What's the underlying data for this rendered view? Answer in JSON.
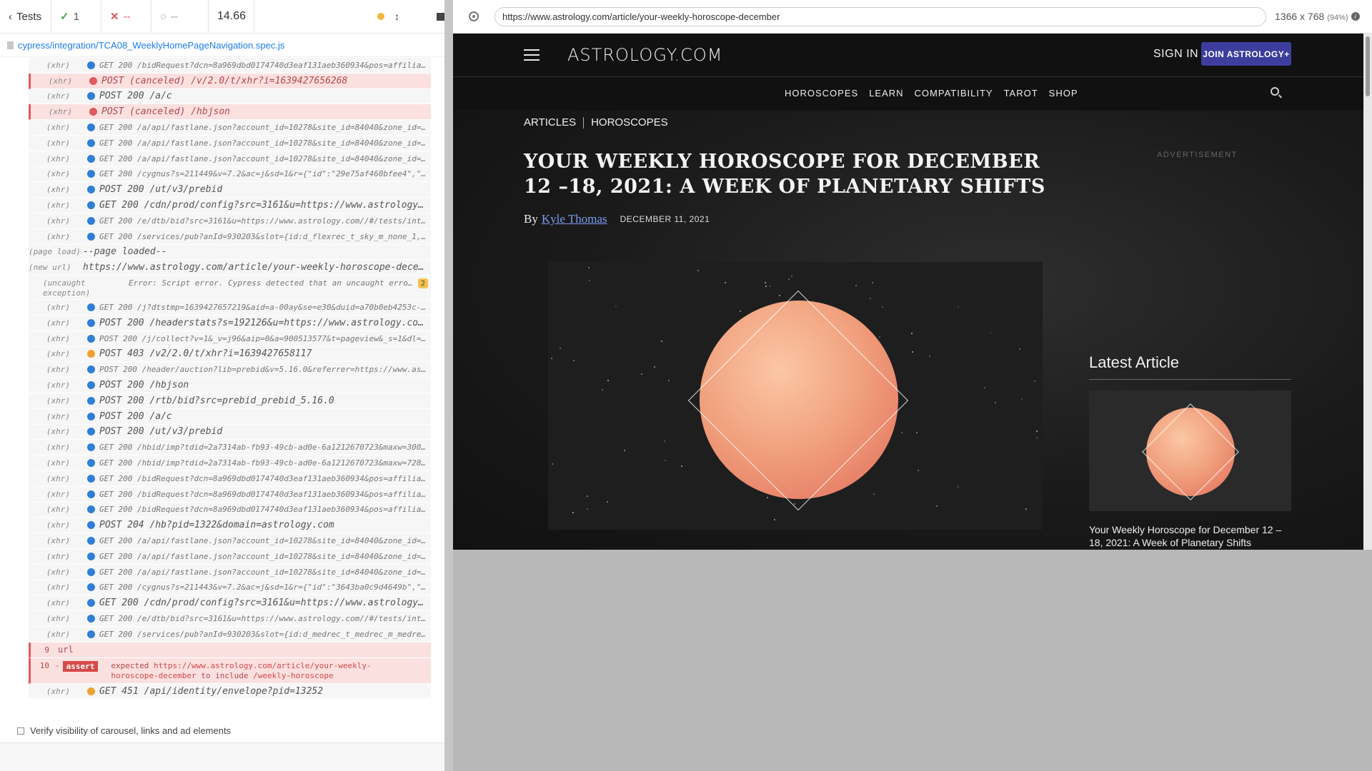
{
  "topbar": {
    "back_label": "Tests",
    "passed": "1",
    "failed": "--",
    "pending": "--",
    "duration": "14.66"
  },
  "spec": {
    "path": "cypress/integration/TCA08_WeeklyHomePageNavigation.spec.js"
  },
  "log": [
    {
      "type": "(xhr)",
      "dot": "blue",
      "msg": "GET 200 /bidRequest?dcn=8a969dbd0174740d3eaf131aeb360934&pos=affiliat…"
    },
    {
      "type": "(xhr)",
      "dot": "red",
      "msg": "POST (canceled) /v/2.0/t/xhr?i=1639427656268",
      "err": true,
      "big": true
    },
    {
      "type": "(xhr)",
      "dot": "blue",
      "msg": "POST 200 /a/c",
      "big": true
    },
    {
      "type": "(xhr)",
      "dot": "red",
      "msg": "POST (canceled) /hbjson",
      "err": true,
      "big": true
    },
    {
      "type": "(xhr)",
      "dot": "blue",
      "msg": "GET 200 /a/api/fastlane.json?account_id=10278&site_id=84040&zone_id=7…"
    },
    {
      "type": "(xhr)",
      "dot": "blue",
      "msg": "GET 200 /a/api/fastlane.json?account_id=10278&site_id=84040&zone_id=7…"
    },
    {
      "type": "(xhr)",
      "dot": "blue",
      "msg": "GET 200 /a/api/fastlane.json?account_id=10278&site_id=84040&zone_id=7…"
    },
    {
      "type": "(xhr)",
      "dot": "blue",
      "msg": "GET 200 /cygnus?s=211449&v=7.2&ac=j&sd=1&r={\"id\":\"29e75af460bfee4\",\"s…"
    },
    {
      "type": "(xhr)",
      "dot": "blue",
      "msg": "POST 200 /ut/v3/prebid",
      "big": true
    },
    {
      "type": "(xhr)",
      "dot": "blue",
      "msg": "GET 200 /cdn/prod/config?src=3161&u=https://www.astrology.…",
      "big": true
    },
    {
      "type": "(xhr)",
      "dot": "blue",
      "msg": "GET 200 /e/dtb/bid?src=3161&u=https://www.astrology.com//#/tests/inte…"
    },
    {
      "type": "(xhr)",
      "dot": "blue",
      "msg": "GET 200 /services/pub?anId=930203&slot={id:d_flexrec_t_sky_m_none_1,s…"
    },
    {
      "type": "(page load)",
      "plain": true,
      "msg": "--page loaded--"
    },
    {
      "type": "(new url)",
      "plain": true,
      "msg": "https://www.astrology.com/article/your-weekly-horoscope-decem…"
    },
    {
      "type": "(uncaught exception)",
      "exception": true,
      "msg": "Error: Script error. Cypress detected that an uncaught error was throw…",
      "count": "2"
    },
    {
      "type": "(xhr)",
      "dot": "blue",
      "msg": "GET 200 /j?dtstmp=1639427657219&aid=a-00ay&se=e30&duid=a70b0eb4253c-…"
    },
    {
      "type": "(xhr)",
      "dot": "blue",
      "msg": "POST 200 /headerstats?s=192126&u=https://www.astrology.com…",
      "big": true
    },
    {
      "type": "(xhr)",
      "dot": "blue",
      "msg": "POST 200 /j/collect?v=1&_v=j96&aip=0&a=900513577&t=pageview&_s=1&dl=h…"
    },
    {
      "type": "(xhr)",
      "dot": "orange",
      "msg": "POST 403 /v2/2.0/t/xhr?i=1639427658117",
      "big": true
    },
    {
      "type": "(xhr)",
      "dot": "blue",
      "msg": "POST 200 /header/auction?lib=prebid&v=5.16.0&referrer=https://www.ast…"
    },
    {
      "type": "(xhr)",
      "dot": "blue",
      "msg": "POST 200 /hbjson",
      "big": true
    },
    {
      "type": "(xhr)",
      "dot": "blue",
      "msg": "POST 200 /rtb/bid?src=prebid_prebid_5.16.0",
      "big": true
    },
    {
      "type": "(xhr)",
      "dot": "blue",
      "msg": "POST 200 /a/c",
      "big": true
    },
    {
      "type": "(xhr)",
      "dot": "blue",
      "msg": "POST 200 /ut/v3/prebid",
      "big": true
    },
    {
      "type": "(xhr)",
      "dot": "blue",
      "msg": "GET 200 /hbid/imp?tdid=2a7314ab-fb93-49cb-ad0e-6a1212670723&maxw=300&…"
    },
    {
      "type": "(xhr)",
      "dot": "blue",
      "msg": "GET 200 /hbid/imp?tdid=2a7314ab-fb93-49cb-ad0e-6a1212670723&maxw=728&…"
    },
    {
      "type": "(xhr)",
      "dot": "blue",
      "msg": "GET 200 /bidRequest?dcn=8a969dbd0174740d3eaf131aeb360934&pos=affiliat…"
    },
    {
      "type": "(xhr)",
      "dot": "blue",
      "msg": "GET 200 /bidRequest?dcn=8a969dbd0174740d3eaf131aeb360934&pos=affiliat…"
    },
    {
      "type": "(xhr)",
      "dot": "blue",
      "msg": "GET 200 /bidRequest?dcn=8a969dbd0174740d3eaf131aeb360934&pos=affiliat…"
    },
    {
      "type": "(xhr)",
      "dot": "blue",
      "msg": "POST 204 /hb?pid=1322&domain=astrology.com",
      "big": true
    },
    {
      "type": "(xhr)",
      "dot": "blue",
      "msg": "GET 200 /a/api/fastlane.json?account_id=10278&site_id=84040&zone_id=7…"
    },
    {
      "type": "(xhr)",
      "dot": "blue",
      "msg": "GET 200 /a/api/fastlane.json?account_id=10278&site_id=84040&zone_id=7…"
    },
    {
      "type": "(xhr)",
      "dot": "blue",
      "msg": "GET 200 /a/api/fastlane.json?account_id=10278&site_id=84040&zone_id=7…"
    },
    {
      "type": "(xhr)",
      "dot": "blue",
      "msg": "GET 200 /cygnus?s=211443&v=7.2&ac=j&sd=1&r={\"id\":\"3643ba0c9d4649b\",\"s…"
    },
    {
      "type": "(xhr)",
      "dot": "blue",
      "msg": "GET 200 /cdn/prod/config?src=3161&u=https://www.astrology.…",
      "big": true
    },
    {
      "type": "(xhr)",
      "dot": "blue",
      "msg": "GET 200 /e/dtb/bid?src=3161&u=https://www.astrology.com//#/tests/inte…"
    },
    {
      "type": "(xhr)",
      "dot": "blue",
      "msg": "GET 200 /services/pub?anId=930203&slot={id:d_medrec_t_medrec_m_medrec…"
    }
  ],
  "assertion": {
    "url_num": "9",
    "url_label": "url",
    "assert_num": "10",
    "assert_dash": "-",
    "assert_tag": "assert",
    "expected_word": "expected",
    "expected_url": "https://www.astrology.com/article/your-weekly-horoscope-december",
    "to_include": "to include",
    "include_value": "/weekly-horoscope"
  },
  "last_log": {
    "type": "(xhr)",
    "dot": "orange",
    "msg": "GET 451 /api/identity/envelope?pid=13252"
  },
  "verify_label": "Verify visibility of carousel, links and ad elements",
  "browser": {
    "url": "https://www.astrology.com/article/your-weekly-horoscope-december",
    "viewport": "1366 x 768",
    "zoom": "(94%)"
  },
  "site": {
    "logo": "ASTROLOGY.COM",
    "signin": "SIGN IN",
    "join": "JOIN ASTROLOGY+",
    "nav": [
      "HOROSCOPES",
      "LEARN",
      "COMPATIBILITY",
      "TAROT",
      "SHOP"
    ],
    "crumbs": [
      "ARTICLES",
      "HOROSCOPES"
    ],
    "title": "YOUR WEEKLY HOROSCOPE FOR DECEMBER 12 –18, 2021: A WEEK OF PLANETARY SHIFTS",
    "by": "By",
    "author": "Kyle Thomas",
    "date": "DECEMBER 11, 2021",
    "advertisement": "ADVERTISEMENT",
    "latest_heading": "Latest Article",
    "latest_caption": "Your Weekly Horoscope for December 12 – 18, 2021: A Week of Planetary Shifts"
  }
}
